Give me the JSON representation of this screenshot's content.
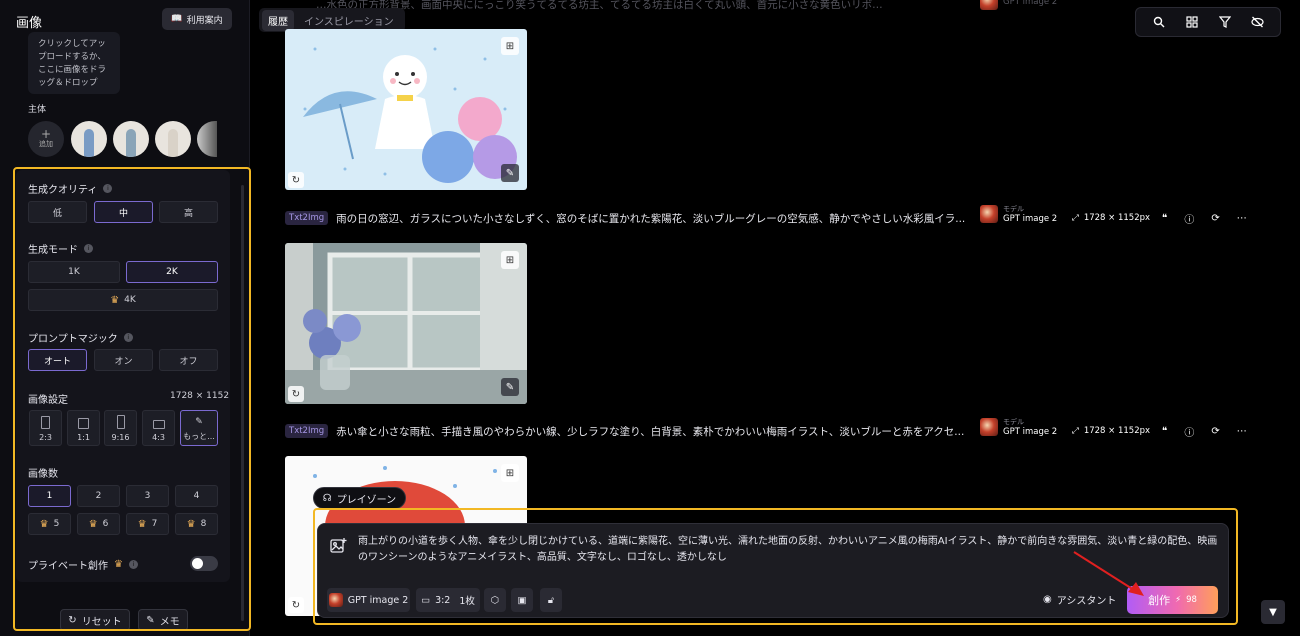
{
  "sidebar": {
    "title": "画像",
    "guide_label": "利用案内",
    "upload_hint": "クリックしてアップロードするか、ここに画像をドラッグ＆ドロップ",
    "subject_label": "主体",
    "add_label": "追加",
    "quality": {
      "label": "生成クオリティ",
      "options": [
        "低",
        "中",
        "高"
      ],
      "selected": "中"
    },
    "mode": {
      "label": "生成モード",
      "options": [
        "1K",
        "2K",
        "4K"
      ],
      "selected": "2K"
    },
    "magic": {
      "label": "プロンプトマジック",
      "options": [
        "オート",
        "オン",
        "オフ"
      ],
      "selected": "オート"
    },
    "image_settings": {
      "label": "画像設定",
      "size": "1728 × 1152",
      "ratios": [
        "2:3",
        "1:1",
        "9:16",
        "4:3",
        "もっと..."
      ]
    },
    "count": {
      "label": "画像数",
      "options": [
        "1",
        "2",
        "3",
        "4",
        "5",
        "6",
        "7",
        "8"
      ],
      "selected": "1"
    },
    "private_label": "プライベート創作",
    "private_enabled": false,
    "reset_label": "リセット",
    "memo_label": "メモ"
  },
  "tabs": [
    "履歴",
    "インスピレーション"
  ],
  "top_partial_text": "…水色の正方形背景、画面中央ににっこり笑うてるてる坊主、てるてる坊主は白くて丸い頭、首元に小さな黄色いリボ…",
  "generations": [
    {
      "tag": "Txt2Img",
      "prompt": "雨の日の窓辺、ガラスについた小さなしずく、窓のそばに置かれた紫陽花、淡いブルーグレーの空気感、静かでやさしい水彩風イラ...",
      "model_label": "モデル",
      "model": "GPT image 2",
      "size": "1728 × 1152px"
    },
    {
      "tag": "Txt2Img",
      "prompt": "赤い傘と小さな雨粒、手描き風のやわらかい線、少しラフな塗り、白背景、素朴でかわいい梅雨イラスト、淡いブルーと赤をアクセ...",
      "model_label": "モデル",
      "model": "GPT image 2",
      "size": "1728 × 1152px"
    }
  ],
  "composer": {
    "playzone_label": "プレイゾーン",
    "prompt": "雨上がりの小道を歩く人物、傘を少し閉じかけている、道端に紫陽花、空に薄い光、濡れた地面の反射、かわいいアニメ風の梅雨AIイラスト、静かで前向きな雰囲気、淡い青と緑の配色、映画のワンシーンのようなアニメイラスト、高品質、文字なし、ロゴなし、透かしなし",
    "model": "GPT image 2",
    "ratio": "3:2",
    "count": "1枚",
    "assistant_label": "アシスタント",
    "create_label": "創作",
    "credits": "98"
  },
  "colors": {
    "accent": "#7b6ad0",
    "highlight": "#f2b824",
    "tag": "#a596e4"
  }
}
